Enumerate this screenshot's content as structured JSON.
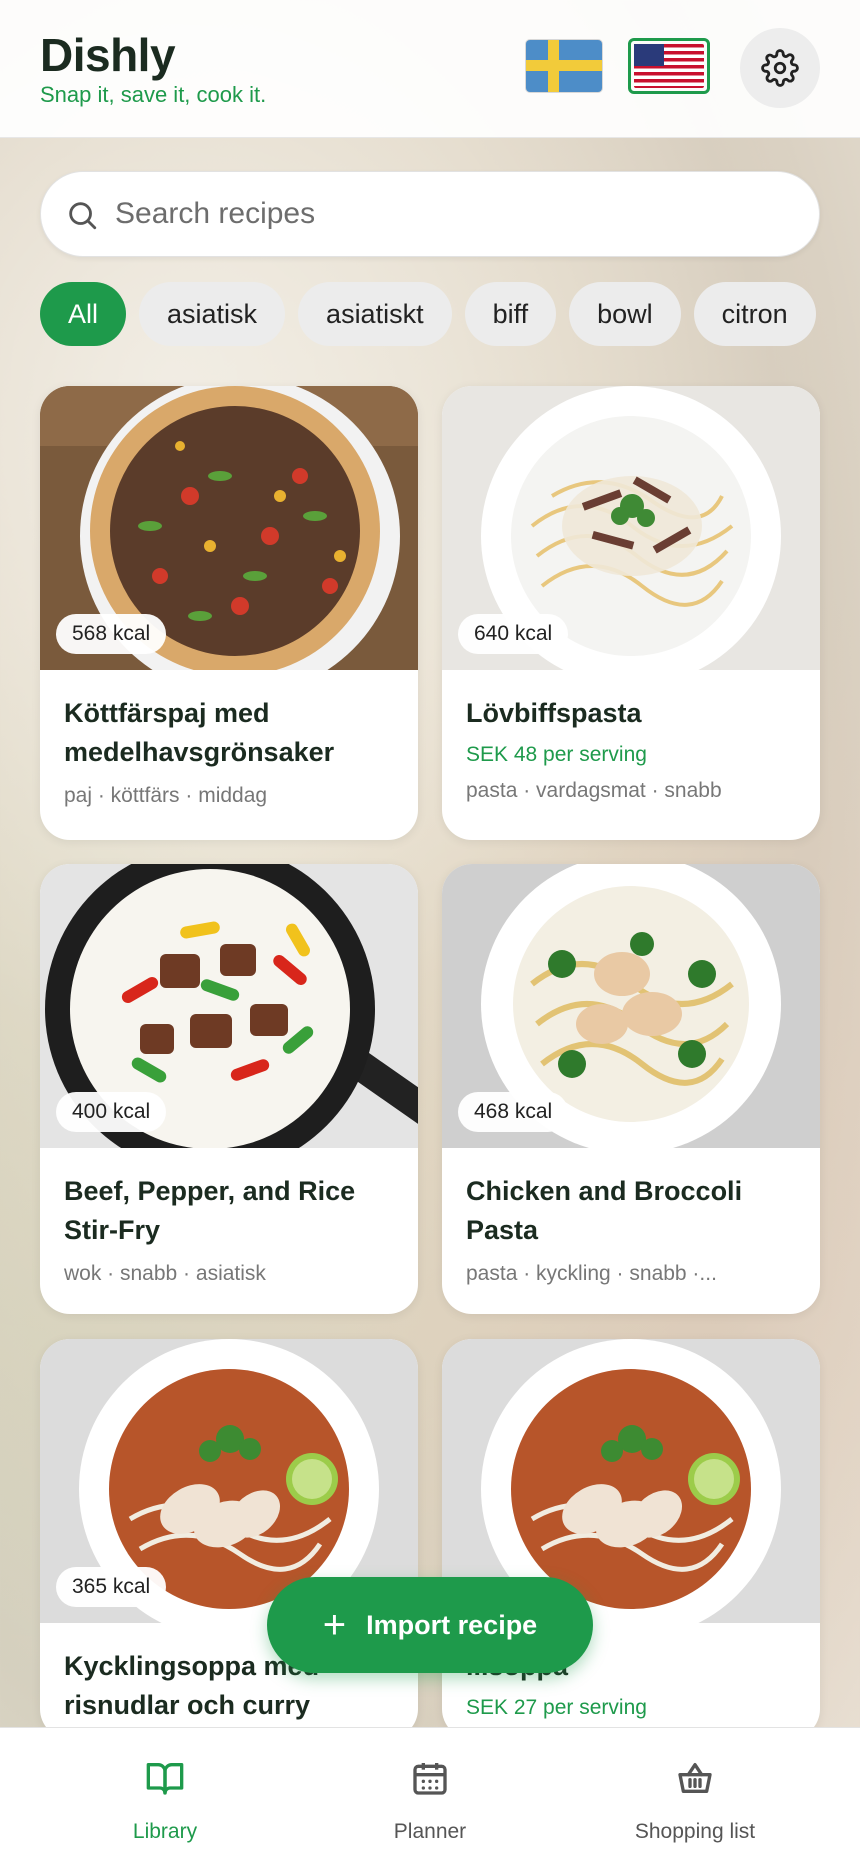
{
  "header": {
    "app_name": "Dishly",
    "tagline": "Snap it, save it, cook it.",
    "languages": [
      {
        "code": "sv",
        "icon": "sweden-flag-icon",
        "selected": false
      },
      {
        "code": "en",
        "icon": "us-flag-icon",
        "selected": true
      }
    ],
    "settings_icon": "gear-icon"
  },
  "search": {
    "placeholder": "Search recipes",
    "value": "",
    "icon": "search-icon"
  },
  "filters": [
    {
      "label": "All",
      "active": true
    },
    {
      "label": "asiatisk",
      "active": false
    },
    {
      "label": "asiatiskt",
      "active": false
    },
    {
      "label": "biff",
      "active": false
    },
    {
      "label": "bowl",
      "active": false
    },
    {
      "label": "citron",
      "active": false
    }
  ],
  "recipes": [
    {
      "kcal": "568 kcal",
      "title": "Köttfärspaj med medelhavsgrönsaker",
      "price": "",
      "tags": "paj · köttfärs · middag"
    },
    {
      "kcal": "640 kcal",
      "title": "Lövbiffspasta",
      "price": "SEK 48 per serving",
      "tags": "pasta · vardagsmat · snabb"
    },
    {
      "kcal": "400 kcal",
      "title": "Beef, Pepper, and Rice Stir-Fry",
      "price": "",
      "tags": "wok · snabb · asiatisk"
    },
    {
      "kcal": "468 kcal",
      "title": "Chicken and Broccoli Pasta",
      "price": "",
      "tags": "pasta · kyckling · snabb ·..."
    },
    {
      "kcal": "365 kcal",
      "title": "Kycklingsoppa med risnudlar och curry",
      "price": "",
      "tags": ""
    },
    {
      "kcal": "",
      "title": "...soppa",
      "price": "SEK 27 per serving",
      "tags": ""
    }
  ],
  "fab": {
    "label": "Import recipe",
    "icon": "plus-icon"
  },
  "nav": [
    {
      "label": "Library",
      "icon": "book-icon",
      "active": true
    },
    {
      "label": "Planner",
      "icon": "calendar-icon",
      "active": false
    },
    {
      "label": "Shopping list",
      "icon": "basket-icon",
      "active": false
    }
  ],
  "colors": {
    "accent": "#1e9a4b",
    "title": "#1b2b20"
  }
}
